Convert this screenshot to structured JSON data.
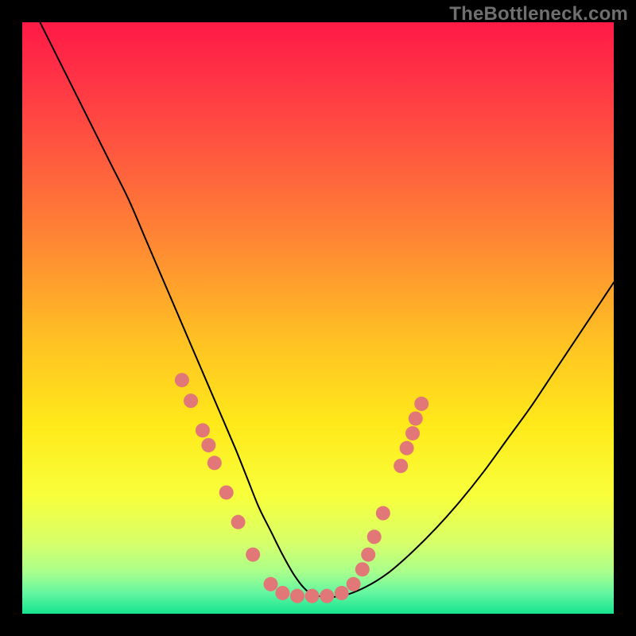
{
  "watermark": "TheBottleneck.com",
  "chart_data": {
    "type": "line",
    "title": "",
    "xlabel": "",
    "ylabel": "",
    "xlim": [
      0,
      100
    ],
    "ylim": [
      0,
      100
    ],
    "grid": false,
    "legend": false,
    "background": {
      "type": "vertical-gradient",
      "stops": [
        {
          "pos": 0.0,
          "color": "#ff1a46"
        },
        {
          "pos": 0.08,
          "color": "#ff2f46"
        },
        {
          "pos": 0.22,
          "color": "#ff583f"
        },
        {
          "pos": 0.38,
          "color": "#ff8a33"
        },
        {
          "pos": 0.54,
          "color": "#ffc223"
        },
        {
          "pos": 0.68,
          "color": "#ffe91a"
        },
        {
          "pos": 0.8,
          "color": "#f8ff3b"
        },
        {
          "pos": 0.88,
          "color": "#d7ff6a"
        },
        {
          "pos": 0.93,
          "color": "#a8ff8c"
        },
        {
          "pos": 0.965,
          "color": "#63f6a0"
        },
        {
          "pos": 1.0,
          "color": "#17e38f"
        }
      ]
    },
    "series": [
      {
        "name": "bottleneck-curve",
        "stroke": "#000000",
        "stroke_width": 2,
        "x": [
          3,
          6,
          9,
          12,
          15,
          18,
          21,
          24,
          27,
          30,
          33,
          36,
          38,
          40,
          42,
          44,
          46,
          48,
          50,
          54,
          58,
          62,
          66,
          70,
          74,
          78,
          82,
          86,
          90,
          94,
          98,
          100
        ],
        "y": [
          100,
          94,
          88,
          82,
          76,
          70,
          63,
          56,
          49,
          42,
          35,
          28,
          23,
          18,
          14,
          10,
          6.5,
          4,
          3,
          3,
          4.5,
          7,
          10.5,
          14.5,
          19,
          24,
          29.5,
          35,
          41,
          47,
          53,
          56
        ]
      }
    ],
    "markers": {
      "color": "#e17777",
      "radius_px": 9,
      "points_xy": [
        [
          27,
          39.5
        ],
        [
          28.5,
          36
        ],
        [
          30.5,
          31
        ],
        [
          31.5,
          28.5
        ],
        [
          32.5,
          25.5
        ],
        [
          34.5,
          20.5
        ],
        [
          36.5,
          15.5
        ],
        [
          39,
          10
        ],
        [
          42,
          5
        ],
        [
          44,
          3.5
        ],
        [
          46.5,
          3
        ],
        [
          49,
          3
        ],
        [
          51.5,
          3
        ],
        [
          54,
          3.5
        ],
        [
          56,
          5
        ],
        [
          57.5,
          7.5
        ],
        [
          58.5,
          10
        ],
        [
          59.5,
          13
        ],
        [
          61,
          17
        ],
        [
          64,
          25
        ],
        [
          65,
          28
        ],
        [
          66,
          30.5
        ],
        [
          66.5,
          33
        ],
        [
          67.5,
          35.5
        ]
      ]
    }
  }
}
